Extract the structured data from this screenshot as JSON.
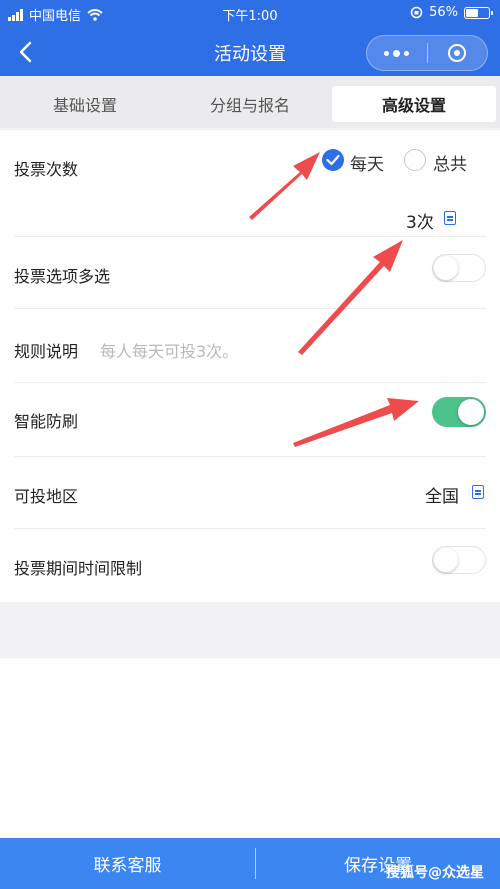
{
  "status_bar": {
    "carrier": "中国电信",
    "time": "下午1:00",
    "battery": "56%",
    "battery_level": 0.56
  },
  "nav": {
    "title": "活动设置"
  },
  "tabs": [
    {
      "label": "基础设置",
      "active": false
    },
    {
      "label": "分组与报名",
      "active": false
    },
    {
      "label": "高级设置",
      "active": true
    }
  ],
  "vote_count": {
    "label": "投票次数",
    "options": [
      "每天",
      "总共"
    ],
    "selected": "每天",
    "value": "3次"
  },
  "multi_select": {
    "label": "投票选项多选",
    "on": false
  },
  "rules": {
    "label": "规则说明",
    "text": "每人每天可投3次。"
  },
  "anti_spam": {
    "label": "智能防刷",
    "on": true
  },
  "region": {
    "label": "可投地区",
    "value": "全国"
  },
  "time_limit": {
    "label": "投票期间时间限制",
    "on": false
  },
  "footer": {
    "contact": "联系客服",
    "save": "保存设置"
  },
  "watermark": "搜狐号@众选星",
  "colors": {
    "primary": "#2f6fe6",
    "toggle_on": "#4cc38a",
    "arrow": "#ee4c4c"
  }
}
